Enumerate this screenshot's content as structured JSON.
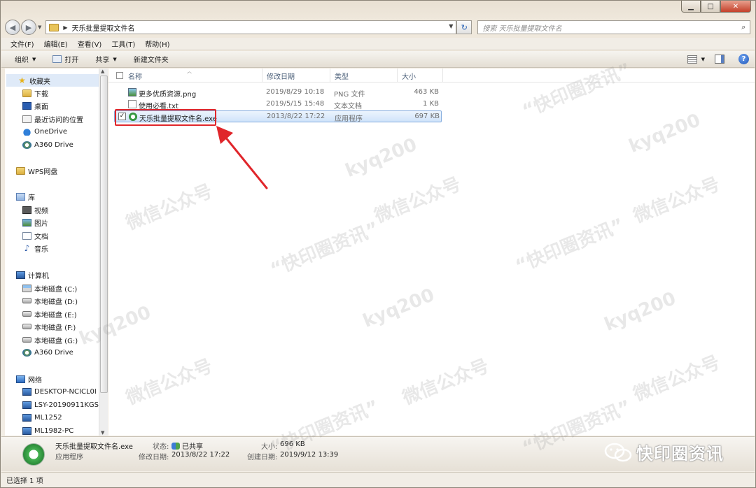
{
  "window": {
    "address_path": "天乐批量提取文件名",
    "search_placeholder": "搜索 天乐批量提取文件名"
  },
  "menu": [
    "文件(F)",
    "编辑(E)",
    "查看(V)",
    "工具(T)",
    "帮助(H)"
  ],
  "toolbar": {
    "organize": "组织",
    "open": "打开",
    "share": "共享",
    "new_folder": "新建文件夹"
  },
  "sidebar": {
    "favorites": "收藏夹",
    "downloads": "下载",
    "desktop": "桌面",
    "recent": "最近访问的位置",
    "onedrive": "OneDrive",
    "a360": "A360 Drive",
    "wps": "WPS网盘",
    "libraries": "库",
    "videos": "视频",
    "pictures": "图片",
    "documents": "文档",
    "music": "音乐",
    "computer": "计算机",
    "drive_c": "本地磁盘 (C:)",
    "drive_d": "本地磁盘 (D:)",
    "drive_e": "本地磁盘 (E:)",
    "drive_f": "本地磁盘 (F:)",
    "drive_g": "本地磁盘 (G:)",
    "a360_2": "A360 Drive",
    "network": "网络",
    "net1": "DESKTOP-NCICL0I",
    "net2": "LSY-20190911KGS",
    "net3": "ML1252",
    "net4": "ML1982-PC"
  },
  "columns": {
    "name": "名称",
    "modified": "修改日期",
    "type": "类型",
    "size": "大小"
  },
  "files": [
    {
      "name": "更多优质资源.png",
      "modified": "2019/8/29 10:18",
      "type": "PNG 文件",
      "size": "463 KB"
    },
    {
      "name": "使用必看.txt",
      "modified": "2019/5/15 15:48",
      "type": "文本文档",
      "size": "1 KB"
    },
    {
      "name": "天乐批量提取文件名.exe",
      "modified": "2013/8/22 17:22",
      "type": "应用程序",
      "size": "697 KB"
    }
  ],
  "details": {
    "filename": "天乐批量提取文件名.exe",
    "filetype": "应用程序",
    "status_label": "状态:",
    "status_value": "已共享",
    "modified_label": "修改日期:",
    "modified_value": "2013/8/22 17:22",
    "size_label": "大小:",
    "size_value": "696 KB",
    "created_label": "创建日期:",
    "created_value": "2019/9/12 13:39"
  },
  "status_bar": "已选择 1 项",
  "brand": "快印圈资讯",
  "watermarks": [
    "“快印圈资讯”",
    "微信公众号",
    "kyq200"
  ],
  "colors": {
    "selection_border": "#84acdd",
    "highlight_box": "#e0262b",
    "arrow": "#e0262b"
  }
}
